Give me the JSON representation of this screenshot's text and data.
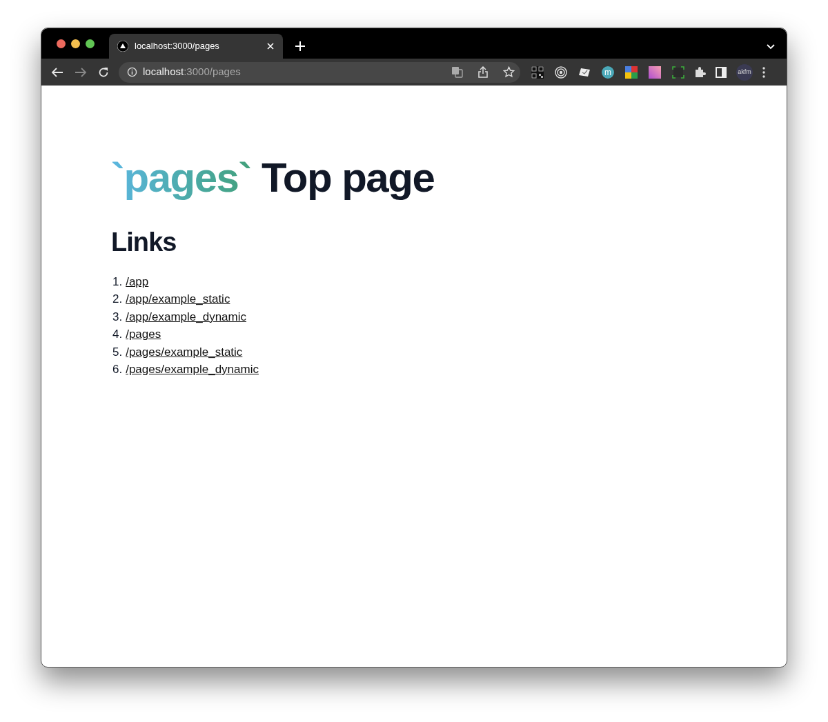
{
  "tab": {
    "title": "localhost:3000/pages",
    "selected": true
  },
  "address": {
    "host": "localhost",
    "path": ":3000/pages"
  },
  "extensions": [
    {
      "kind": "qr"
    },
    {
      "kind": "target"
    },
    {
      "kind": "note"
    },
    {
      "kind": "letter",
      "text": "m",
      "color": "#4aa8b8"
    },
    {
      "kind": "colorful"
    },
    {
      "kind": "gradient"
    },
    {
      "kind": "frame"
    }
  ],
  "profile": {
    "text": "akfm"
  },
  "heading": {
    "code": "`pages`",
    "text": "Top page"
  },
  "subheading": "Links",
  "links": [
    {
      "number": "1.",
      "text": "/app"
    },
    {
      "number": "2.",
      "text": "/app/example_static"
    },
    {
      "number": "3.",
      "text": "/app/example_dynamic"
    },
    {
      "number": "4.",
      "text": "/pages"
    },
    {
      "number": "5.",
      "text": "/pages/example_static"
    },
    {
      "number": "6.",
      "text": "/pages/example_dynamic"
    }
  ]
}
